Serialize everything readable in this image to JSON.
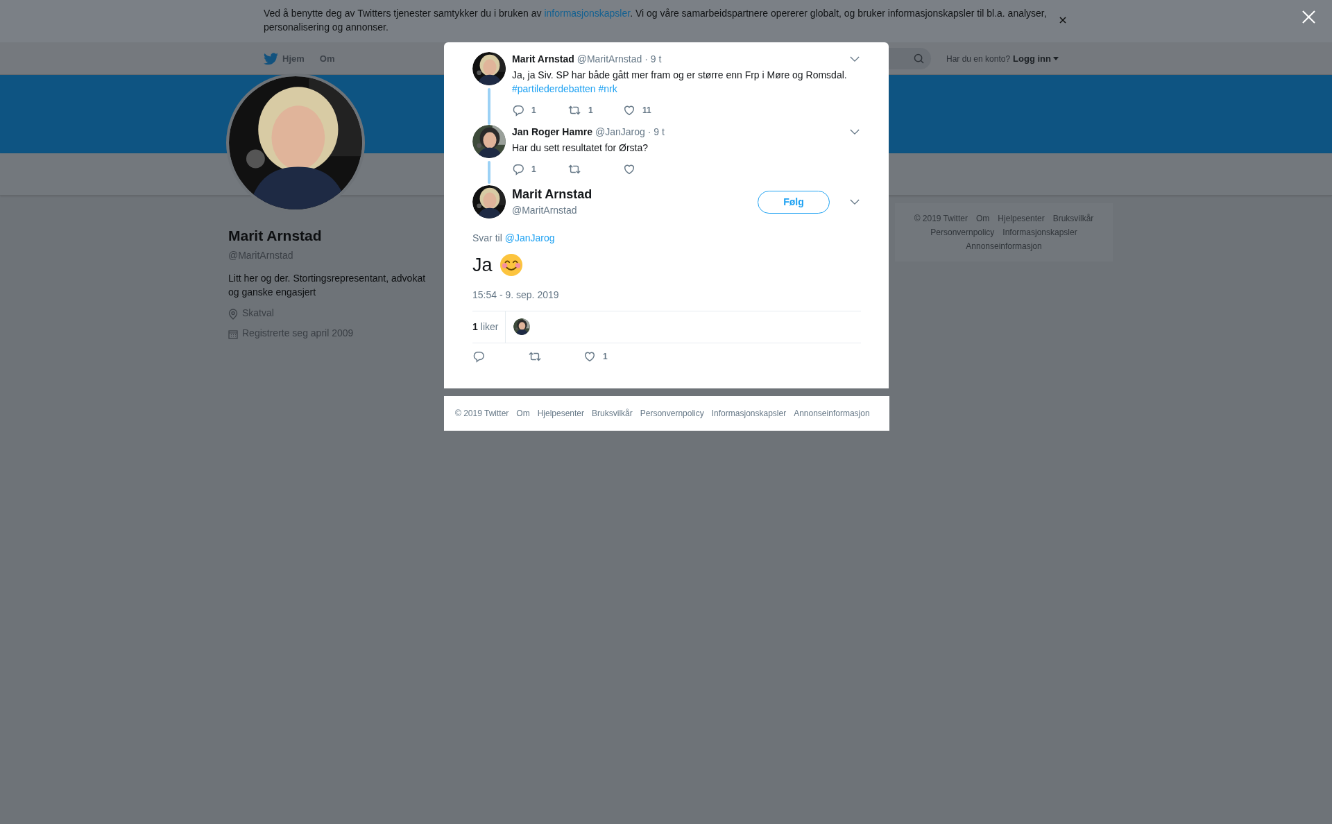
{
  "consent_banner": {
    "text_before": "Ved å benytte deg av Twitters tjenester samtykker du i bruken av ",
    "link": "informasjonskapsler",
    "text_after": ". Vi og våre samarbeidspartnere opererer globalt, og bruker informasjonskapsler til bl.a. analyser, personalisering og annonser."
  },
  "nav": {
    "items": [
      {
        "label": "Hjem",
        "kind": "home"
      },
      {
        "label": "Om",
        "kind": "plain"
      }
    ],
    "account_prompt": "Har du en konto?",
    "login": "Logg inn"
  },
  "profile": {
    "name": "Marit Arnstad",
    "handle": "@MaritArnstad",
    "bio": "Litt her og der. Stortingsrepresentant, advokat og ganske engasjert",
    "location": "Skatval",
    "joined": "Registrerte seg april 2009"
  },
  "side_footer": {
    "links": [
      "© 2019 Twitter",
      "Om",
      "Hjelpesenter",
      "Bruksvilkår",
      "Personvernpolicy",
      "Informasjonskapsler",
      "Annonseinformasjon"
    ]
  },
  "thread": [
    {
      "name": "Marit Arnstad",
      "handle": "@MaritArnstad",
      "time": "· 9 t",
      "text": "Ja, ja Siv. SP har både gått mer fram og er større enn Frp i Møre og Romsdal.",
      "hashtags": [
        "#partilederdebatten",
        "#nrk"
      ],
      "replies": "1",
      "retweets": "1",
      "likes": "11"
    },
    {
      "name": "Jan Roger Hamre",
      "handle": "@JanJarog",
      "time": "· 9 t",
      "text": "Har du sett resultatet for Ørsta?",
      "replies": "1"
    }
  ],
  "main_tweet": {
    "name": "Marit Arnstad",
    "handle": "@MaritArnstad",
    "follow_button": "Følg",
    "reply_label": "Svar til",
    "reply_to": "@JanJarog",
    "text": "Ja",
    "timestamp": "15:54 - 9. sep. 2019",
    "like_count": "1",
    "like_label": "liker",
    "likes": "1"
  },
  "modal_footer": {
    "links": [
      "© 2019 Twitter",
      "Om",
      "Hjelpesenter",
      "Bruksvilkår",
      "Personvernpolicy",
      "Informasjonskapsler",
      "Annonseinformasjon"
    ]
  }
}
